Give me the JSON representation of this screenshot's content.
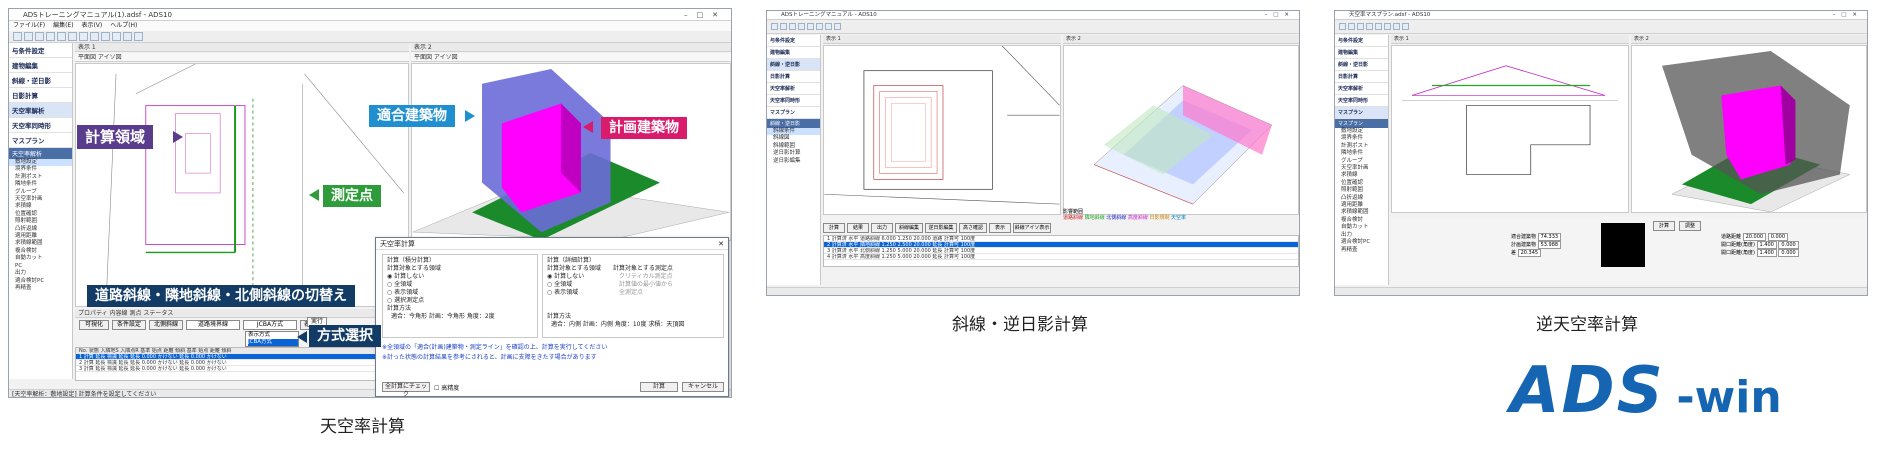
{
  "shot1": {
    "title": "ADSトレーニングマニュアル(1).adsf - ADS10",
    "menu": [
      "ファイル(F)",
      "編集(E)",
      "表示(V)",
      "ヘルプ(H)"
    ],
    "sidebar_heads": [
      "与条件設定",
      "建物編集",
      "斜線・逆日影",
      "日影計算",
      "天空率解析",
      "天空率同時形",
      "マスプラン"
    ],
    "sidebar_group": "天空率解析",
    "sidebar_items": [
      "敷地設定",
      "境界条件",
      "計測ポスト",
      "隣地条件",
      "グループ",
      "天空率計画",
      "求積線",
      "位置確認",
      "照射範囲",
      "凸折返線",
      "適用距離",
      "求積線範囲",
      "複合検討",
      "自動カット",
      "PC",
      "出力",
      "適合検討PC",
      "再精査"
    ],
    "view_left": "表示 1",
    "view_left_tabs": "平面図  アイソ図",
    "view_right": "表示 2",
    "view_right_tabs": "平面図  アイソ図",
    "callouts": {
      "calc_area": "計算領域",
      "fit_building": "適合建築物",
      "plan_building": "計画建築物",
      "measure_point": "測定点",
      "switch_slope": "道路斜線・隣地斜線・北側斜線の切替え",
      "method_select": "方式選択"
    },
    "props_tabs": "プロパティ  内容線  測点  ステータス",
    "props_buttons": [
      "可視化",
      "条件設定",
      "北側斜線",
      "道路境界線",
      "JCBA方式",
      "表示"
    ],
    "dropdown_options": [
      "表示方式",
      "JCBA方式"
    ],
    "grid_header": "No.  状態  入隣地S  入隣点R  基準  始点  距離  傾斜  基準  始点  距離  傾斜",
    "grid_rows": [
      "1   計算  延長  標識  延長  延長  0.000  かけない  延長  0.000  かけない",
      "2   計算  延長  標識  延長  延長  0.000  かけない  延長  0.000  かけない",
      "3   計算  延長  標識  延長  延長  0.000  かけない  延長  0.000  かけない"
    ],
    "status": "[天空率解析：敷地設定] 計算条件を設定してください",
    "dialog": {
      "title": "天空率計算",
      "group1": "計算（積分計算）",
      "group1_sub": "計算対象とする領域",
      "group1_opts": [
        "計算しない",
        "全領域",
        "表示領域",
        "選択測定点"
      ],
      "method1": "計算方法",
      "method1_val": "適合：今角形  計画：今角形  角度：2度",
      "group2": "計算（詳細計算）",
      "group2_sub": "計算対象とする領域",
      "group2_opts": [
        "計算しない",
        "全領域",
        "表示領域"
      ],
      "group2_points": "計算対象とする測定点",
      "group2_point_opts": [
        "クリティカル測定点",
        "計算値の最小値から",
        "全測定点"
      ],
      "method2": "計算方法",
      "method2_val": "適合：内側  計画：内側  角度：10度  求積：天頂図",
      "note1": "※全領域の「適合(計画)建築物・測定ライン」を確認の上、計算を実行してください",
      "note2": "※計った状態の計算結果を参考にされると、計画に支障をきたす場合があります",
      "btn_check": "全計算にチェック",
      "chk_high": "高精度",
      "btn_calc": "計算",
      "btn_cancel": "キャンセル",
      "btn_run": "実行"
    }
  },
  "shot2": {
    "title": "ADSトレーニングマニュアル - ADS10",
    "sidebar_heads": [
      "与条件設定",
      "建物編集",
      "斜線・逆日影",
      "日影計算",
      "天空率解析",
      "天空率同時形",
      "マスプラン"
    ],
    "sidebar_group": "斜線・逆日影",
    "sidebar_items": [
      "斜線条件",
      "斜線図",
      "斜線範囲",
      "逆日影計算",
      "逆日影編集"
    ],
    "view_left": "表示 1",
    "view_right": "表示 2",
    "tabs": [
      "計算",
      "結果",
      "出力",
      "斜線編集",
      "逆日影編集",
      "高さ確認",
      "表示",
      "斜線アイソ表示"
    ],
    "legend_label": "影響範囲",
    "legend": [
      "道路斜線",
      "隣地斜線",
      "北側斜線",
      "高度斜線",
      "日影規制",
      "天空率"
    ],
    "rows": [
      "1  計算済  水平  道路斜線  6.000  1.250  20.000  道路  計算可  100度",
      "2  計算済  水平  隣地斜線  1.250  2.500  20.000  延長  計算可  100度",
      "3  計算済  水平  北側斜線  1.250  5.000  20.000  延長  計算可  100度",
      "4  計算済  水平  高度斜線  1.250  5.000  20.000  延長  計算可  100度"
    ]
  },
  "shot3": {
    "title": "天空率マスプラン.adsf - ADS10",
    "sidebar_heads": [
      "与条件設定",
      "建物編集",
      "斜線・逆日影",
      "日影計算",
      "天空率解析",
      "天空率同時形",
      "マスプラン"
    ],
    "sidebar_group": "マスプラン",
    "sidebar_items": [
      "敷地設定",
      "境界条件",
      "計測ポスト",
      "隣地条件",
      "グループ",
      "天空率計画",
      "求積線",
      "位置確認",
      "照射範囲",
      "凸折返線",
      "適用距離",
      "求積線範囲",
      "複合検討",
      "自動カット",
      "出力",
      "適合検討PC",
      "再精査"
    ],
    "view_left": "表示 1",
    "view_right": "表示 2",
    "panel_fields": [
      [
        "適合建築物",
        "74.333"
      ],
      [
        "計画建築物",
        "53.988"
      ],
      [
        "差",
        "20.345"
      ]
    ],
    "panel_buttons": [
      "計算",
      "調整"
    ],
    "right_fields": [
      [
        "道路距離",
        "20.000"
      ],
      [
        "開口距離(角度)",
        "1.400"
      ],
      [
        "開口距離(角度)",
        "1.400"
      ]
    ],
    "right_vals": [
      "0.000",
      "0.000",
      "0.000"
    ]
  },
  "captions": {
    "cap1": "天空率計算",
    "cap2": "斜線・逆日影計算",
    "cap3": "逆天空率計算"
  },
  "logo": {
    "ads": "ADS",
    "win": "-win"
  },
  "colors": {
    "callout_purple": "#5a3c8c",
    "callout_blue": "#1f8fd0",
    "callout_pink": "#d81b6a",
    "callout_green": "#2e9c3a",
    "callout_dark": "#123c66",
    "building_magenta": "#ff00ff",
    "building_blue": "#6b6bd8",
    "logo_blue": "#1565b3"
  }
}
